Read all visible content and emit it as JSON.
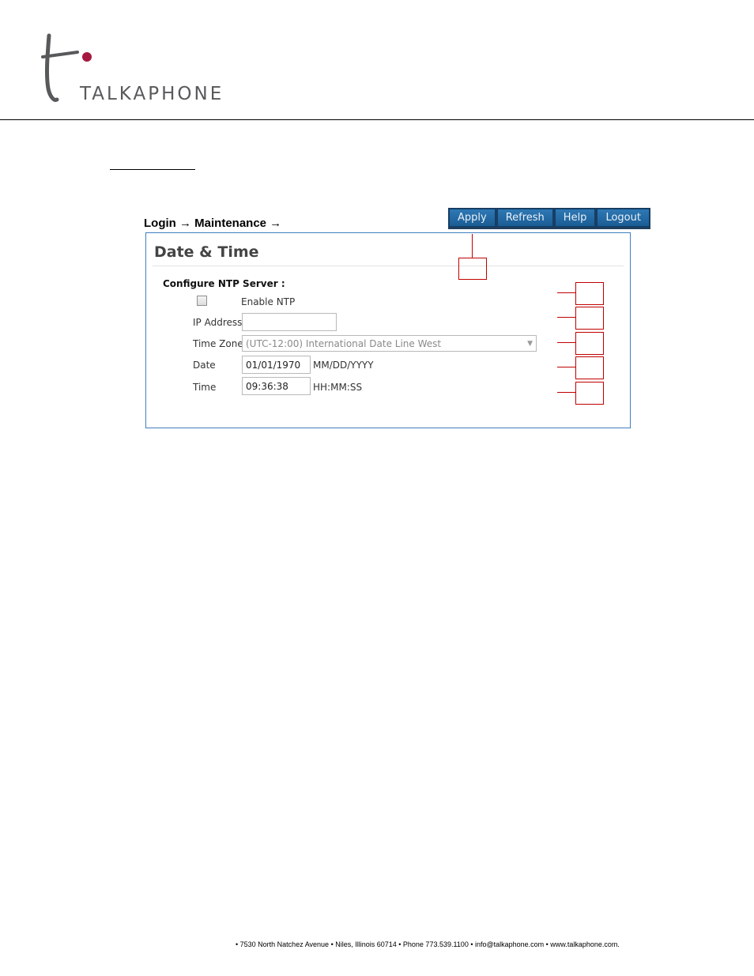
{
  "header": {
    "brand": "TALKAPHONE",
    "accent_color": "#a5193f",
    "logo_color": "#58595b"
  },
  "breadcrumb": "Login → Maintenance →",
  "toolbar": {
    "buttons": [
      "Apply",
      "Refresh",
      "Help",
      "Logout"
    ]
  },
  "panel": {
    "title": "Date & Time",
    "section_title": "Configure NTP Server :",
    "enable_ntp": {
      "label": "Enable NTP",
      "checked": false
    },
    "ip_address": {
      "label": "IP Address",
      "value": ""
    },
    "time_zone": {
      "label": "Time Zone",
      "value": "(UTC-12:00) International Date Line West"
    },
    "date": {
      "label": "Date",
      "value": "01/01/1970",
      "format": "MM/DD/YYYY"
    },
    "time": {
      "label": "Time",
      "value": "09:36:38",
      "format": "HH:MM:SS"
    }
  },
  "callout_color": "#c00000",
  "footer": "• 7530 North Natchez Avenue • Niles, Illinois 60714 • Phone 773.539.1100 • info@talkaphone.com • www.talkaphone.com."
}
